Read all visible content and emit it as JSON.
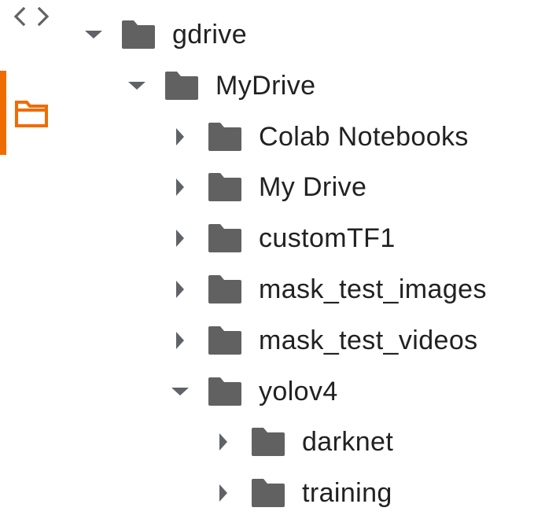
{
  "colors": {
    "accent": "#ef6c00",
    "icon": "#5f6368",
    "folder": "#616161",
    "text": "#212121"
  },
  "rail": {
    "code_icon": "code-icon",
    "files_icon": "folder-outline-icon",
    "active": "files"
  },
  "tree": {
    "nodes": [
      {
        "name": "gdrive",
        "depth": 0,
        "state": "expanded",
        "icon": "folder-icon"
      },
      {
        "name": "MyDrive",
        "depth": 1,
        "state": "expanded",
        "icon": "folder-icon"
      },
      {
        "name": "Colab Notebooks",
        "depth": 2,
        "state": "collapsed",
        "icon": "folder-icon"
      },
      {
        "name": "My Drive",
        "depth": 2,
        "state": "collapsed",
        "icon": "folder-icon"
      },
      {
        "name": "customTF1",
        "depth": 2,
        "state": "collapsed",
        "icon": "folder-icon"
      },
      {
        "name": "mask_test_images",
        "depth": 2,
        "state": "collapsed",
        "icon": "folder-icon"
      },
      {
        "name": "mask_test_videos",
        "depth": 2,
        "state": "collapsed",
        "icon": "folder-icon"
      },
      {
        "name": "yolov4",
        "depth": 2,
        "state": "expanded",
        "icon": "folder-icon"
      },
      {
        "name": "darknet",
        "depth": 3,
        "state": "collapsed",
        "icon": "folder-icon"
      },
      {
        "name": "training",
        "depth": 3,
        "state": "collapsed",
        "icon": "folder-icon"
      }
    ]
  }
}
